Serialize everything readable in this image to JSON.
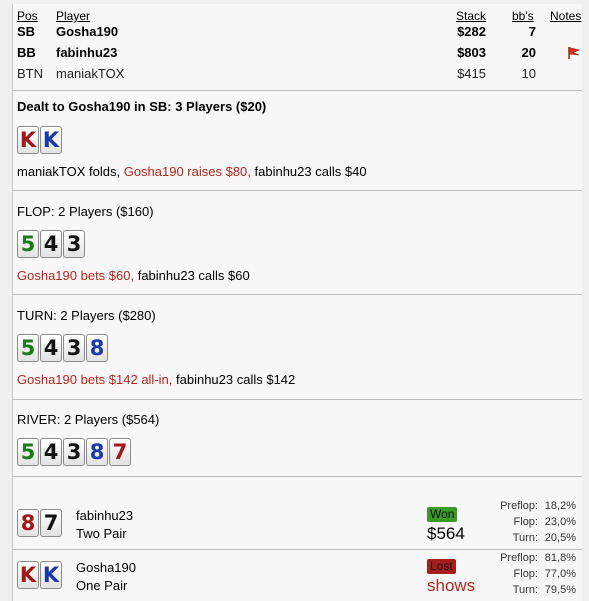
{
  "headers": {
    "pos": "Pos",
    "player": "Player",
    "stack": "Stack",
    "bbs": "bb's",
    "notes": "Notes"
  },
  "players": [
    {
      "pos": "SB",
      "name": "Gosha190",
      "stack": "$282",
      "bbs": "7",
      "bold": true,
      "note_flag": false
    },
    {
      "pos": "BB",
      "name": "fabinhu23",
      "stack": "$803",
      "bbs": "20",
      "bold": true,
      "note_flag": true
    },
    {
      "pos": "BTN",
      "name": "maniakTOX",
      "stack": "$415",
      "bbs": "10",
      "bold": false,
      "note_flag": false
    }
  ],
  "preflop": {
    "title": "Dealt to Gosha190 in SB: 3 Players ($20)",
    "cards": [
      {
        "rank": "K",
        "suit": "hearts"
      },
      {
        "rank": "K",
        "suit": "diamonds"
      }
    ],
    "actions": [
      {
        "text": "maniakTOX folds, ",
        "hero": false
      },
      {
        "text": "Gosha190 raises $80, ",
        "hero": true
      },
      {
        "text": "fabinhu23 calls $40",
        "hero": false
      }
    ]
  },
  "flop": {
    "title": "FLOP: 2 Players ($160)",
    "cards": [
      {
        "rank": "5",
        "suit": "clubs"
      },
      {
        "rank": "4",
        "suit": "spades"
      },
      {
        "rank": "3",
        "suit": "spades"
      }
    ],
    "actions": [
      {
        "text": "Gosha190 bets $60, ",
        "hero": true
      },
      {
        "text": "fabinhu23 calls $60",
        "hero": false
      }
    ]
  },
  "turn": {
    "title": "TURN: 2 Players ($280)",
    "cards": [
      {
        "rank": "5",
        "suit": "clubs"
      },
      {
        "rank": "4",
        "suit": "spades"
      },
      {
        "rank": "3",
        "suit": "spades"
      },
      {
        "rank": "8",
        "suit": "diamonds"
      }
    ],
    "actions": [
      {
        "text": "Gosha190 bets $142 all-in, ",
        "hero": true
      },
      {
        "text": "fabinhu23 calls $142",
        "hero": false
      }
    ]
  },
  "river": {
    "title": "RIVER: 2 Players ($564)",
    "cards": [
      {
        "rank": "5",
        "suit": "clubs"
      },
      {
        "rank": "4",
        "suit": "spades"
      },
      {
        "rank": "3",
        "suit": "spades"
      },
      {
        "rank": "8",
        "suit": "diamonds"
      },
      {
        "rank": "7",
        "suit": "hearts"
      }
    ]
  },
  "showdown": [
    {
      "name": "fabinhu23",
      "hand": "Two Pair",
      "cards": [
        {
          "rank": "8",
          "suit": "hearts"
        },
        {
          "rank": "7",
          "suit": "spades"
        }
      ],
      "badge": "Won",
      "result_text": "$564",
      "result_color": "#000000",
      "equity": [
        {
          "label": "Preflop:",
          "value": "18,2%"
        },
        {
          "label": "Flop:",
          "value": "23,0%"
        },
        {
          "label": "Turn:",
          "value": "20,5%"
        }
      ]
    },
    {
      "name": "Gosha190",
      "hand": "One Pair",
      "cards": [
        {
          "rank": "K",
          "suit": "hearts"
        },
        {
          "rank": "K",
          "suit": "diamonds"
        }
      ],
      "badge": "Lost",
      "result_text": "shows",
      "result_color": "#b3261e",
      "equity": [
        {
          "label": "Preflop:",
          "value": "81,8%"
        },
        {
          "label": "Flop:",
          "value": "77,0%"
        },
        {
          "label": "Turn:",
          "value": "79,5%"
        }
      ]
    }
  ]
}
